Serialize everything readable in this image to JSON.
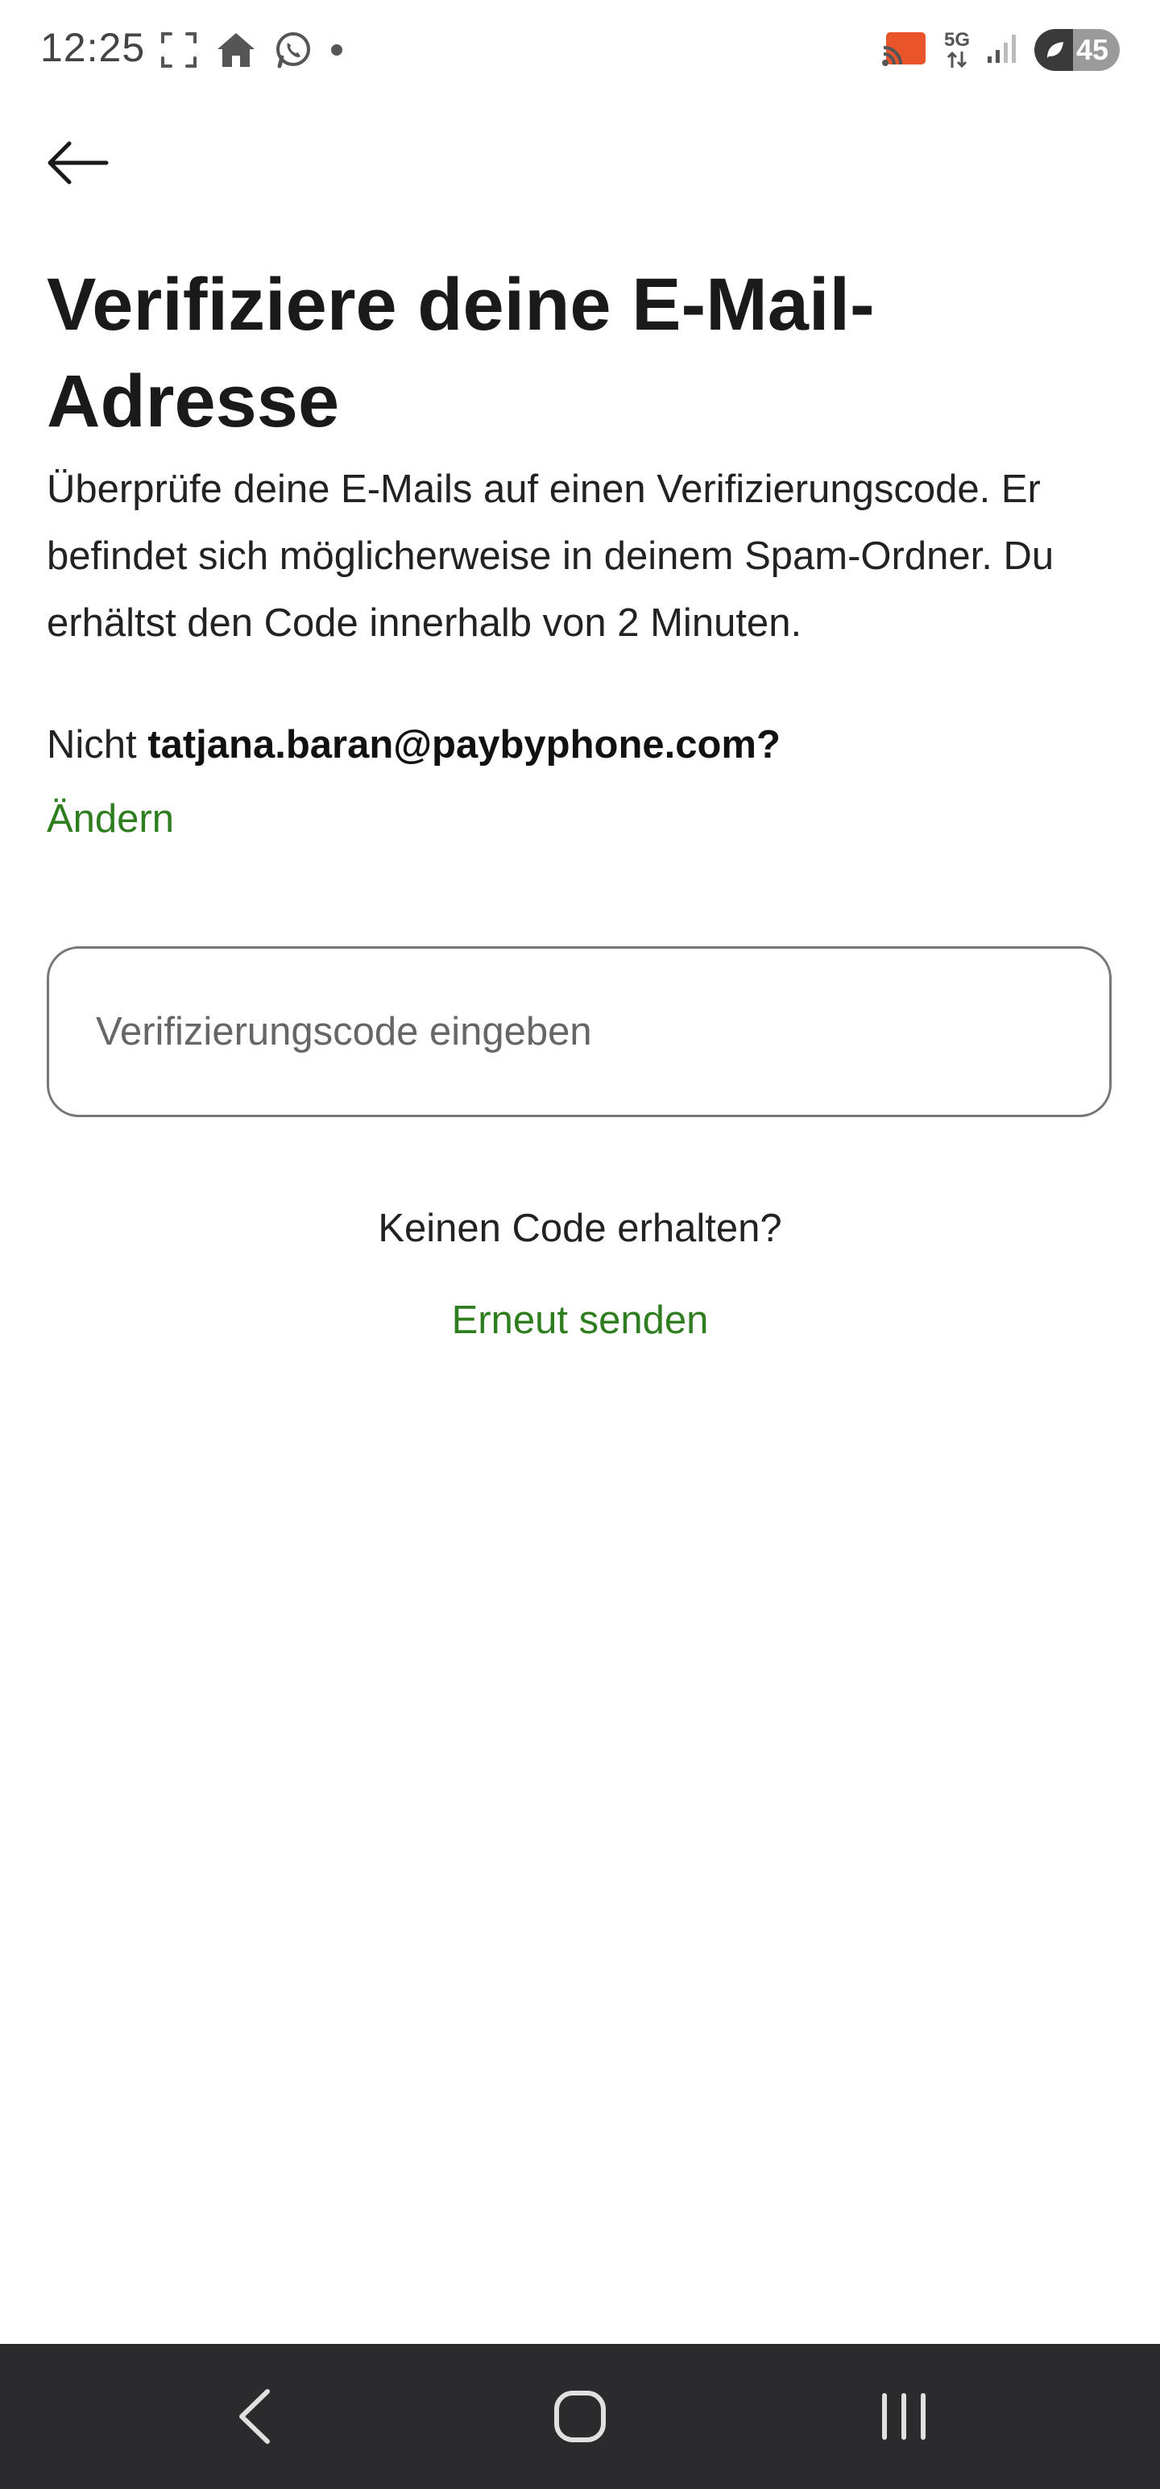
{
  "status_bar": {
    "time": "12:25",
    "left_icons": [
      "screenshot-icon",
      "home-icon",
      "whatsapp-icon",
      "notification-dot-icon"
    ],
    "right_icons": [
      "cast-icon",
      "5g-icon",
      "signal-icon"
    ],
    "network": "5G",
    "battery_level": "45"
  },
  "header": {
    "back_icon": "back-arrow-icon"
  },
  "main": {
    "title": "Verifiziere deine E-Mail-Adresse",
    "description": "Überprüfe deine E-Mails auf einen Verifizierungscode. Er befindet sich möglicherweise in deinem Spam-Ordner. Du erhältst den Code innerhalb von 2 Minuten.",
    "not_you_prefix": "Nicht",
    "email": "tatjana.baran@paybyphone.com?",
    "change_link": "Ändern",
    "code_input": {
      "placeholder": "Verifizierungscode eingeben",
      "value": ""
    },
    "no_code_text": "Keinen Code erhalten?",
    "resend_link": "Erneut senden"
  },
  "colors": {
    "accent": "#2e7d1f",
    "text": "#1a1a1a",
    "input_border": "#777777",
    "nav_bar": "#2b2b2d"
  },
  "nav_bar": {
    "icons": [
      "nav-back-icon",
      "nav-home-icon",
      "nav-recents-icon"
    ]
  }
}
